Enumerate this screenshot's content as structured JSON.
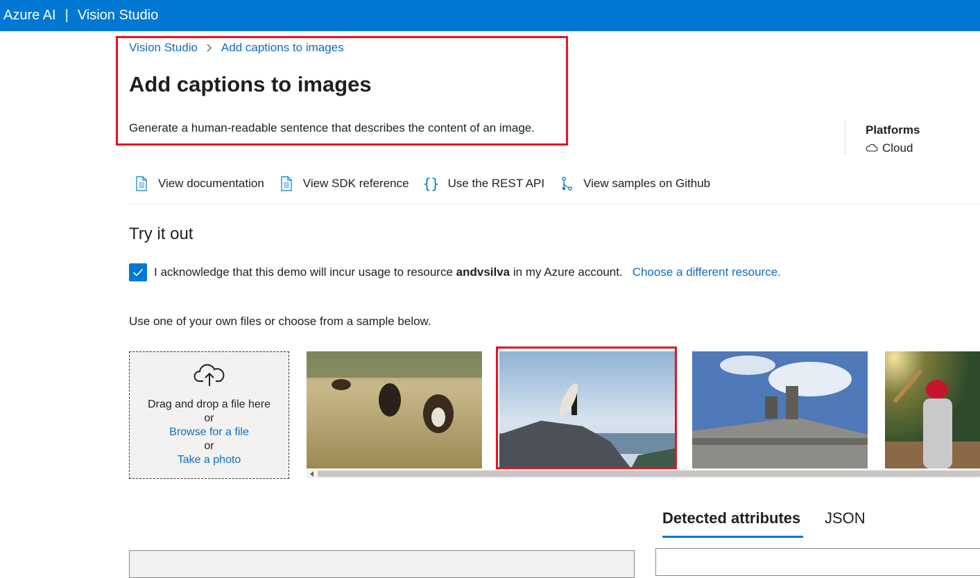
{
  "header": {
    "brand": "Azure AI",
    "separator": "|",
    "product": "Vision Studio"
  },
  "breadcrumb": {
    "root": "Vision Studio",
    "current": "Add captions to images"
  },
  "page": {
    "title": "Add captions to images",
    "description": "Generate a human-readable sentence that describes the content of an image."
  },
  "platforms": {
    "label": "Platforms",
    "items": [
      "Cloud"
    ]
  },
  "resources": [
    {
      "label": "View documentation",
      "icon": "document-icon"
    },
    {
      "label": "View SDK reference",
      "icon": "document-icon"
    },
    {
      "label": "Use the REST API",
      "icon": "braces-icon"
    },
    {
      "label": "View samples on Github",
      "icon": "branch-icon"
    }
  ],
  "try_it": {
    "title": "Try it out",
    "acknowledge": {
      "checked": true,
      "text_before": "I acknowledge that this demo will incur usage to resource",
      "resource": "andvsilva",
      "text_after": "in my Azure account.",
      "choose_link": "Choose a different resource."
    },
    "instructions": "Use one of your own files or choose from a sample below.",
    "dropzone": {
      "drag_text": "Drag and drop a file here",
      "or1": "or",
      "browse": "Browse for a file",
      "or2": "or",
      "photo": "Take a photo"
    },
    "samples": [
      {
        "subject": "cows grazing in a field",
        "selected": false
      },
      {
        "subject": "surfer holding a surfboard on a rock",
        "selected": true
      },
      {
        "subject": "statues on top of a building",
        "selected": false
      },
      {
        "subject": "baseball player batting",
        "selected": false
      }
    ]
  },
  "results": {
    "tabs": [
      {
        "label": "Detected attributes",
        "active": true
      },
      {
        "label": "JSON",
        "active": false
      }
    ]
  },
  "colors": {
    "brand_blue": "#0078d4",
    "link": "#0f6cbd",
    "highlight_red": "#e81123"
  }
}
